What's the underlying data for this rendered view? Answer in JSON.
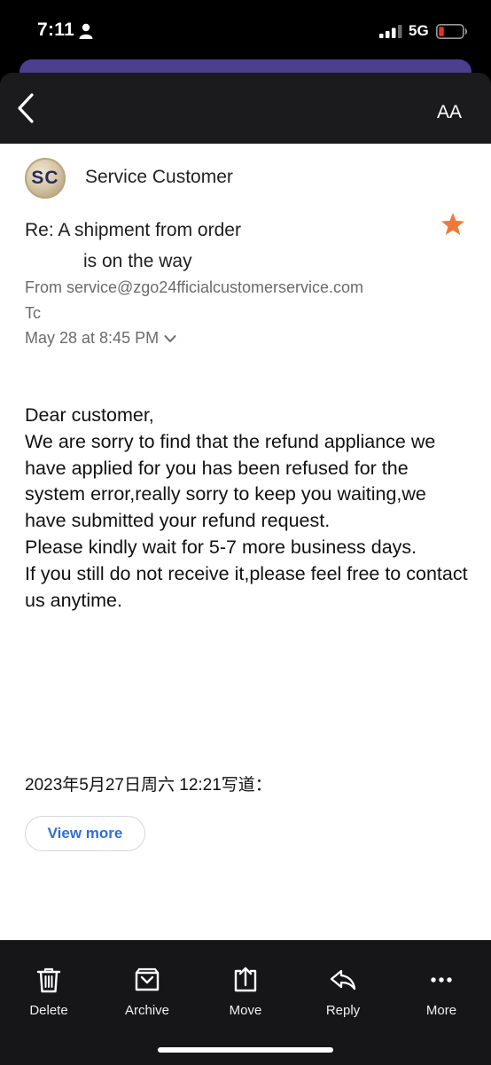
{
  "status_bar": {
    "time": "7:11",
    "network": "5G"
  },
  "nav": {
    "back_label": "Back",
    "text_size_glyph": "AA"
  },
  "email": {
    "avatar_initials": "SC",
    "sender_name": "Service Customer",
    "subject_line1": "Re: A shipment from order",
    "subject_line2": "is on the way",
    "from_text": "From service@zgo24fficialcustomerservice.com",
    "to_text": "Tc",
    "date_text": "May 28 at 8:45 PM",
    "starred": true,
    "body_lines": [
      "Dear customer,",
      "We are sorry to find that the refund appliance we have applied for you has been refused for the system error,really sorry to keep you waiting,we have submitted your refund request.",
      "Please kindly wait for 5-7 more business days.",
      "If you still do not receive it,please feel free to contact us anytime."
    ],
    "quote_header": "2023年5月27日周六 12:21写道：",
    "view_more_label": "View more"
  },
  "toolbar": {
    "items": [
      {
        "label": "Delete",
        "icon": "trash-icon"
      },
      {
        "label": "Archive",
        "icon": "archive-icon"
      },
      {
        "label": "Move",
        "icon": "move-icon"
      },
      {
        "label": "Reply",
        "icon": "reply-icon"
      },
      {
        "label": "More",
        "icon": "more-icon"
      }
    ]
  },
  "colors": {
    "accent_star": "#f0783a",
    "link_blue": "#2f6fd6",
    "battery_low": "#e5332b",
    "sheet_purple": "#4b3f8f"
  }
}
